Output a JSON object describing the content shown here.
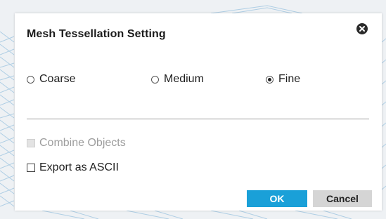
{
  "dialog": {
    "title": "Mesh Tessellation Setting",
    "close_icon": "close-icon",
    "tessellation": {
      "options": [
        {
          "label": "Coarse",
          "checked": false
        },
        {
          "label": "Medium",
          "checked": false
        },
        {
          "label": "Fine",
          "checked": true
        }
      ],
      "selected": "Fine"
    },
    "checkboxes": [
      {
        "label": "Combine Objects",
        "checked": false,
        "disabled": true
      },
      {
        "label": "Export as ASCII",
        "checked": false,
        "disabled": false
      }
    ],
    "buttons": {
      "ok_label": "OK",
      "cancel_label": "Cancel"
    }
  },
  "colors": {
    "primary_button": "#1aa0d8",
    "secondary_button": "#d5d5d5",
    "backdrop": "#eef1f4"
  }
}
